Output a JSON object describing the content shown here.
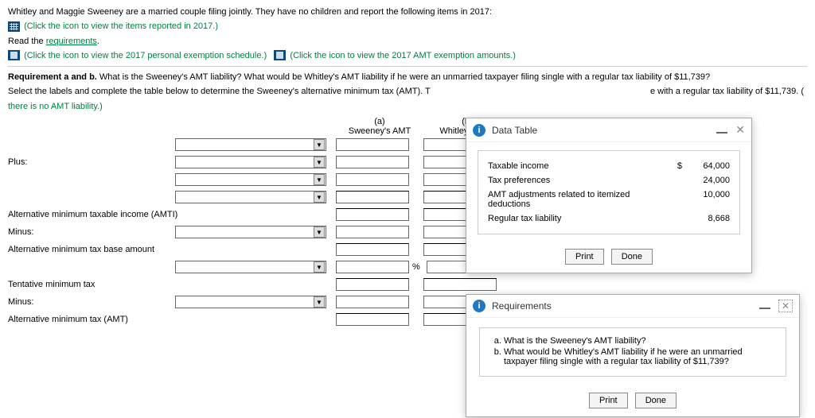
{
  "intro": {
    "line1": "Whitley and Maggie Sweeney are a married couple filing jointly. They have no children and report the following items in 2017:",
    "iconLink1": "(Click the icon to view the items reported in 2017.)",
    "readThe": "Read the ",
    "requirementsWord": "requirements",
    "period": ".",
    "iconLink2": "(Click the icon to view the 2017 personal exemption schedule.)",
    "iconLink3": "(Click the icon to view the 2017 AMT exemption amounts.)"
  },
  "req": {
    "heading": "Requirement a and b.",
    "text": " What is the Sweeney's AMT liability? What would be Whitley's AMT liability if he were an unmarried taxpayer filing single with a regular tax liability of $11,739?"
  },
  "instr": {
    "pre": "Select the labels and complete the table below to determine the Sweeney's alternative minimum tax (AMT). T",
    "post": "e with a regular tax liability of $11,739. (",
    "hint": "there is no AMT liability.)"
  },
  "cols": {
    "aTop": "(a)",
    "aSub": "Sweeney's AMT",
    "bTop": "(b)",
    "bSub": "Whitley's AMT"
  },
  "rows": {
    "plus": "Plus:",
    "amti": "Alternative minimum taxable income (AMTI)",
    "minus": "Minus:",
    "base": "Alternative minimum tax base amount",
    "tent": "Tentative minimum tax",
    "amt": "Alternative minimum tax (AMT)",
    "pct": "%"
  },
  "dataTable": {
    "title": "Data Table",
    "r1l": "Taxable income",
    "r1c": "$",
    "r1v": "64,000",
    "r2l": "Tax preferences",
    "r2v": "24,000",
    "r3l": "AMT adjustments related to itemized deductions",
    "r3v": "10,000",
    "r4l": "Regular tax liability",
    "r4v": "8,668",
    "print": "Print",
    "done": "Done"
  },
  "requirements": {
    "title": "Requirements",
    "a": "What is the Sweeney's AMT liability?",
    "b": "What would be Whitley's AMT liability if he were an unmarried taxpayer filing single with a regular tax liability of $11,739?",
    "print": "Print",
    "done": "Done"
  }
}
